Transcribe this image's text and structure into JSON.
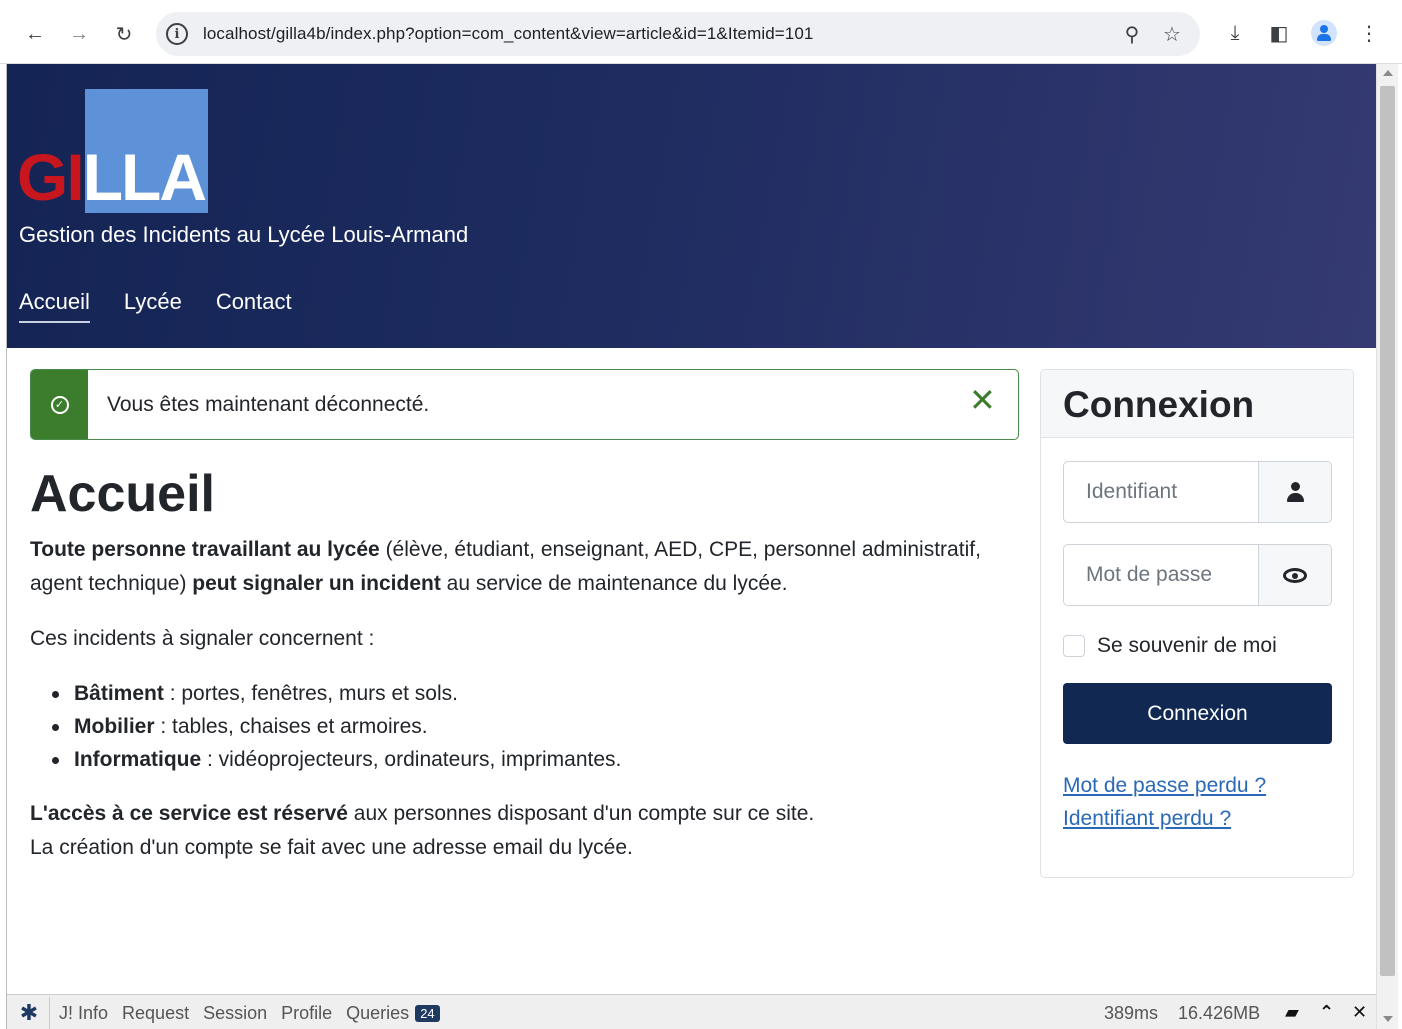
{
  "browser": {
    "url": "localhost/gilla4b/index.php?option=com_content&view=article&id=1&Itemid=101",
    "icons": [
      "back-arrow-icon",
      "forward-arrow-icon",
      "reload-icon",
      "site-info-icon",
      "zoom-icon",
      "star-icon",
      "download-icon",
      "side-panel-icon",
      "profile-icon",
      "kebab-menu-icon"
    ]
  },
  "header": {
    "logo_gi": "GI",
    "logo_lla": "LLA",
    "tagline": "Gestion des Incidents au Lycée Louis-Armand",
    "menu": [
      {
        "label": "Accueil",
        "active": true
      },
      {
        "label": "Lycée",
        "active": false
      },
      {
        "label": "Contact",
        "active": false
      }
    ],
    "colors": {
      "logo_red": "#c8161e",
      "logo_blue": "#5d92d8",
      "header_bg": "#1e2c60"
    }
  },
  "alert": {
    "message": "Vous êtes maintenant déconnecté.",
    "close_glyph": "✕",
    "color": "#3b7d2c"
  },
  "article": {
    "title": "Accueil",
    "p1_b1": "Toute personne travaillant au lycée",
    "p1_t1": " (élève, étudiant, enseignant, AED, CPE, personnel administratif, agent technique) ",
    "p1_b2": "peut signaler un incident",
    "p1_t2": " au service de maintenance du lycée.",
    "p2": "Ces incidents à signaler concernent :",
    "bullets": [
      {
        "term": "Bâtiment",
        "text": " : portes, fenêtres, murs et sols."
      },
      {
        "term": "Mobilier",
        "text": " : tables, chaises et armoires."
      },
      {
        "term": "Informatique",
        "text": " : vidéoprojecteurs, ordinateurs, imprimantes."
      }
    ],
    "p3_b": "L'accès à ce service est réservé",
    "p3_t": " aux personnes disposant d'un compte sur ce site.",
    "p4": "La création d'un compte se fait avec une adresse email du lycée."
  },
  "login": {
    "title": "Connexion",
    "username_placeholder": "Identifiant",
    "password_placeholder": "Mot de passe",
    "remember_label": "Se souvenir de moi",
    "submit_label": "Connexion",
    "forgot_password": "Mot de passe perdu ?",
    "forgot_username": "Identifiant perdu ?",
    "button_color": "#112853"
  },
  "debugbar": {
    "tabs": [
      "J! Info",
      "Request",
      "Session",
      "Profile"
    ],
    "queries_label": "Queries",
    "queries_count": "24",
    "time": "389ms",
    "memory": "16.426MB"
  }
}
